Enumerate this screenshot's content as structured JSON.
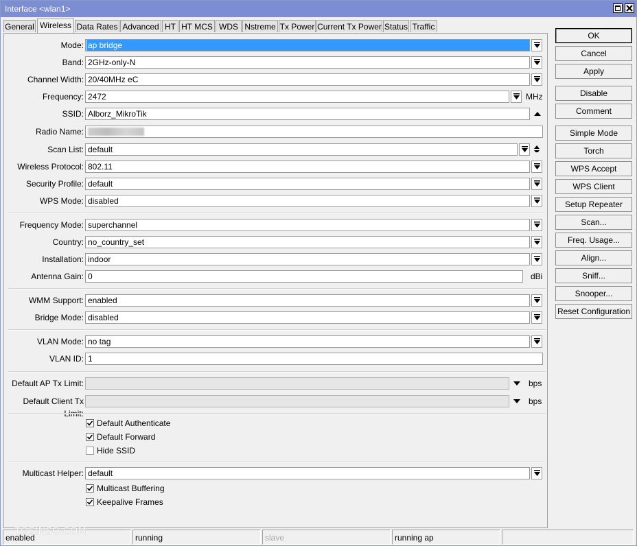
{
  "window": {
    "title": "Interface <wlan1>"
  },
  "tabs": [
    "General",
    "Wireless",
    "Data Rates",
    "Advanced",
    "HT",
    "HT MCS",
    "WDS",
    "Nstreme",
    "Tx Power",
    "Current Tx Power",
    "Status",
    "Traffic"
  ],
  "active_tab": "Wireless",
  "form": {
    "mode": {
      "label": "Mode:",
      "value": "ap bridge"
    },
    "band": {
      "label": "Band:",
      "value": "2GHz-only-N"
    },
    "channel_width": {
      "label": "Channel Width:",
      "value": "20/40MHz eC"
    },
    "frequency": {
      "label": "Frequency:",
      "value": "2472",
      "unit": "MHz"
    },
    "ssid": {
      "label": "SSID:",
      "value": "Alborz_MikroTik"
    },
    "radio_name": {
      "label": "Radio Name:",
      "value": ""
    },
    "scan_list": {
      "label": "Scan List:",
      "value": "default"
    },
    "wireless_protocol": {
      "label": "Wireless Protocol:",
      "value": "802.11"
    },
    "security_profile": {
      "label": "Security Profile:",
      "value": "default"
    },
    "wps_mode": {
      "label": "WPS Mode:",
      "value": "disabled"
    },
    "frequency_mode": {
      "label": "Frequency Mode:",
      "value": "superchannel"
    },
    "country": {
      "label": "Country:",
      "value": "no_country_set"
    },
    "installation": {
      "label": "Installation:",
      "value": "indoor"
    },
    "antenna_gain": {
      "label": "Antenna Gain:",
      "value": "0",
      "unit": "dBi"
    },
    "wmm_support": {
      "label": "WMM Support:",
      "value": "enabled"
    },
    "bridge_mode": {
      "label": "Bridge Mode:",
      "value": "disabled"
    },
    "vlan_mode": {
      "label": "VLAN Mode:",
      "value": "no tag"
    },
    "vlan_id": {
      "label": "VLAN ID:",
      "value": "1"
    },
    "default_ap_tx_limit": {
      "label": "Default AP Tx Limit:",
      "value": "",
      "unit": "bps"
    },
    "default_client_tx_limit": {
      "label": "Default Client Tx Limit:",
      "value": "",
      "unit": "bps"
    },
    "default_authenticate": {
      "label": "Default Authenticate",
      "checked": true
    },
    "default_forward": {
      "label": "Default Forward",
      "checked": true
    },
    "hide_ssid": {
      "label": "Hide SSID",
      "checked": false
    },
    "multicast_helper": {
      "label": "Multicast Helper:",
      "value": "default"
    },
    "multicast_buffering": {
      "label": "Multicast Buffering",
      "checked": true
    },
    "keepalive_frames": {
      "label": "Keepalive Frames",
      "checked": true
    }
  },
  "buttons": {
    "ok": "OK",
    "cancel": "Cancel",
    "apply": "Apply",
    "disable": "Disable",
    "comment": "Comment",
    "simple_mode": "Simple Mode",
    "torch": "Torch",
    "wps_accept": "WPS Accept",
    "wps_client": "WPS Client",
    "setup_repeater": "Setup Repeater",
    "scan": "Scan...",
    "freq_usage": "Freq. Usage...",
    "align": "Align...",
    "sniff": "Sniff...",
    "snooper": "Snooper...",
    "reset_configuration": "Reset Configuration"
  },
  "status_bar": [
    "enabled",
    "running",
    "slave",
    "running ap",
    ""
  ],
  "watermark": "TOSINSO.COM",
  "colors": {
    "titlebar": "#7c8dd3",
    "selection": "#3399ff",
    "background": "#f0f0f0"
  }
}
